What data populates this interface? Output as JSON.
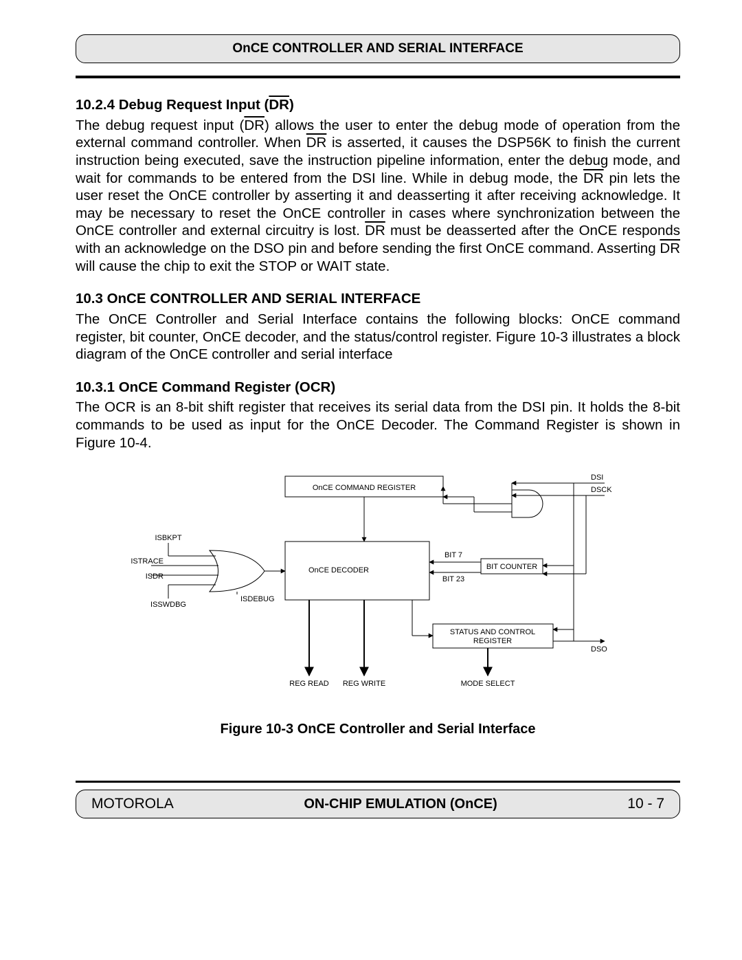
{
  "header": {
    "title": "OnCE CONTROLLER AND SERIAL INTERFACE"
  },
  "sections": {
    "s1": {
      "heading_prefix": "10.2.4   Debug Request Input (",
      "heading_signal": "DR",
      "heading_suffix": ")",
      "body_1": "The debug request input (",
      "body_sig1": "DR",
      "body_2": ") allows the user to enter the debug mode of operation from the external command controller. When ",
      "body_sig2": "DR",
      "body_3": " is asserted, it causes the DSP56K to finish the current instruction being executed, save the instruction pipeline information, enter the debug mode, and wait for commands to be entered from the DSI line. While in debug mode, the ",
      "body_sig3": "DR",
      "body_4": " pin lets the user reset the OnCE controller by asserting it and deasserting it after receiving acknowledge. It may be necessary to reset the OnCE controller in cases where synchronization between the OnCE controller and external circuitry is lost. ",
      "body_sig4": "DR",
      "body_5": " must be deasserted after the OnCE responds with an acknowledge on the DSO pin and before sending the first OnCE command. Asserting ",
      "body_sig5": "DR",
      "body_6": " will cause the chip to exit the STOP or WAIT state."
    },
    "s2": {
      "heading": "10.3   OnCE CONTROLLER AND SERIAL INTERFACE",
      "body": "The OnCE Controller and Serial Interface contains the following blocks: OnCE command register, bit counter, OnCE decoder, and the status/control register. Figure 10-3 illustrates a block diagram of the OnCE controller and serial interface"
    },
    "s3": {
      "heading": "10.3.1   OnCE Command Register (OCR)",
      "body": "The OCR is an 8-bit shift register that receives its serial data from the DSI pin. It holds the 8-bit commands to be used as input for the OnCE Decoder. The Command Register is shown in Figure 10-4."
    }
  },
  "diagram": {
    "cmd_reg": "OnCE COMMAND REGISTER",
    "decoder": "OnCE DECODER",
    "status_ctrl1": "STATUS AND CONTROL",
    "status_ctrl2": "REGISTER",
    "bit_counter": "BIT COUNTER",
    "bit7": "BIT 7",
    "bit23": "BIT 23",
    "dsi": "DSI",
    "dsck": "DSCK",
    "dso": "DSO",
    "isbkpt": "ISBKPT",
    "istrace": "ISTRACE",
    "isdr": "ISDR",
    "isswdbg": "ISSWDBG",
    "isdebug": "ISDEBUG",
    "reg_read": "REG READ",
    "reg_write": "REG WRITE",
    "mode_select": "MODE SELECT"
  },
  "figure_caption": "Figure  10-3 OnCE Controller and Serial Interface",
  "footer": {
    "left": "MOTOROLA",
    "center": "ON-CHIP EMULATION (OnCE)",
    "right": "10 - 7"
  }
}
